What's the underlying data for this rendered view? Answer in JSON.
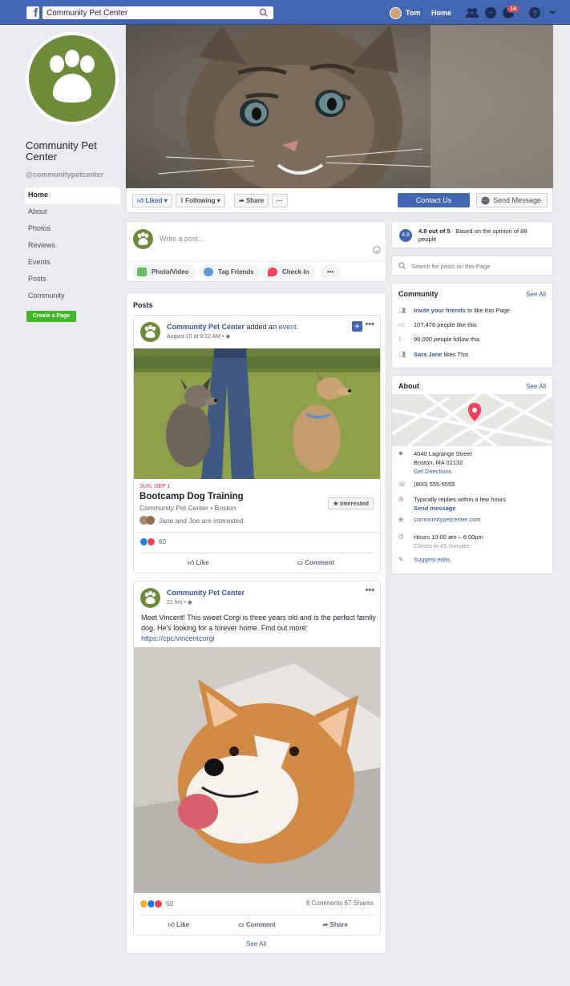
{
  "topbar": {
    "search_value": "Community Pet Center",
    "user_name": "Tom",
    "home_label": "Home",
    "notif_count": "14"
  },
  "page": {
    "name": "Community Pet Center",
    "handle": "@communitypetcenter",
    "brand_color": "#6c8c3a"
  },
  "left_nav": {
    "items": [
      "Home",
      "About",
      "Photos",
      "Reviews",
      "Events",
      "Posts",
      "Community"
    ],
    "create_page": "Create a Page"
  },
  "action_bar": {
    "liked": "Liked",
    "following": "Following",
    "share": "Share",
    "more": "···",
    "contact": "Contact Us",
    "send_message": "Send Message"
  },
  "composer": {
    "placeholder": "Write a post...",
    "photo_video": "Photo/Video",
    "tag_friends": "Tag Friends",
    "check_in": "Check in",
    "more": "•••"
  },
  "posts": {
    "title": "Posts",
    "event_post": {
      "author": "Community Pet Center",
      "action_text": "added an",
      "action_link": "event.",
      "time": "August 10 at 9:12 AM",
      "event_date": "SUN, SEP 1",
      "event_title": "Bootcamp Dog Training",
      "event_sub": "Community Pet Center • Boston",
      "interested_btn": "Interested",
      "friends_interested": "Jane and Joe are interested",
      "reaction_count": "60",
      "like": "Like",
      "comment": "Comment"
    },
    "corgi_post": {
      "author": "Community Pet Center",
      "time": "21 hrs",
      "text": "Meet Vincent! This sweet Corgi is three years old and is the perfect family dog. He's looking for a forever home. Find out more:",
      "url": "https://cpc/vincentcorgi",
      "reaction_count": "50",
      "comments": "8 Comments",
      "shares": "67 Shares",
      "like": "Like",
      "comment": "Comment",
      "share": "Share"
    },
    "see_all": "See All"
  },
  "rating": {
    "score": "4.8",
    "bold": "4.8 out of 5",
    "text": " · Based on the opinion of 88 people"
  },
  "page_search": {
    "placeholder": "Search for posts on this Page"
  },
  "community": {
    "title": "Community",
    "see_all": "See All",
    "invite_link": "Invite your friends",
    "invite_rest": " to like this Page",
    "likes": "107,476 people like this",
    "follows": "99,000 people follow this",
    "friend_link": "Sara Jane",
    "friend_rest": " likes This"
  },
  "about": {
    "title": "About",
    "see_all": "See All",
    "address1": "4040 Lagrange Street",
    "address2": "Boston, MA 02132",
    "directions": "Get Directions",
    "phone": "(800) 555-5555",
    "replies": "Typically replies within a few hours",
    "send_message": "Send message",
    "website": "communitypetcenter.com",
    "hours": "Hours 10:00 am – 6:00pm",
    "closes": "Closes in 45 minutes",
    "suggest": "Suggest edits"
  }
}
